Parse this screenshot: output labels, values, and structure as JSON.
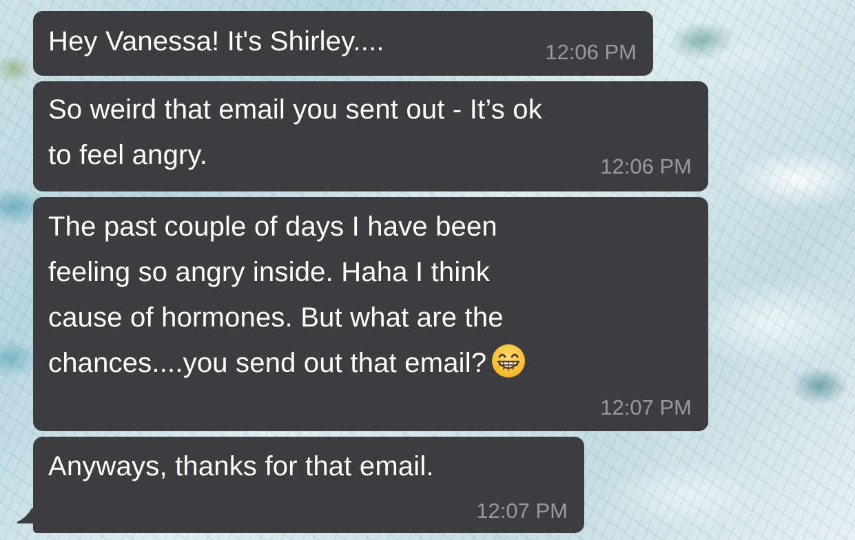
{
  "conversation": {
    "messages": [
      {
        "text": "Hey Vanessa! It's Shirley....",
        "time": "12:06 PM"
      },
      {
        "text": "So weird that email you sent out - It’s ok\nto feel angry.",
        "time": "12:06 PM"
      },
      {
        "text": "The past couple of days I have been\nfeeling so angry inside. Haha I think\ncause of hormones. But what are the\nchances....you send out that email?",
        "time": "12:07 PM",
        "emoji": "grinning-face-with-smiling-eyes"
      },
      {
        "text": "Anyways, thanks for that email.",
        "time": "12:07 PM"
      }
    ]
  },
  "colors": {
    "bubble_background": "#3d3d3f",
    "message_text": "#ffffff",
    "timestamp_text": "#9a9a9c"
  }
}
